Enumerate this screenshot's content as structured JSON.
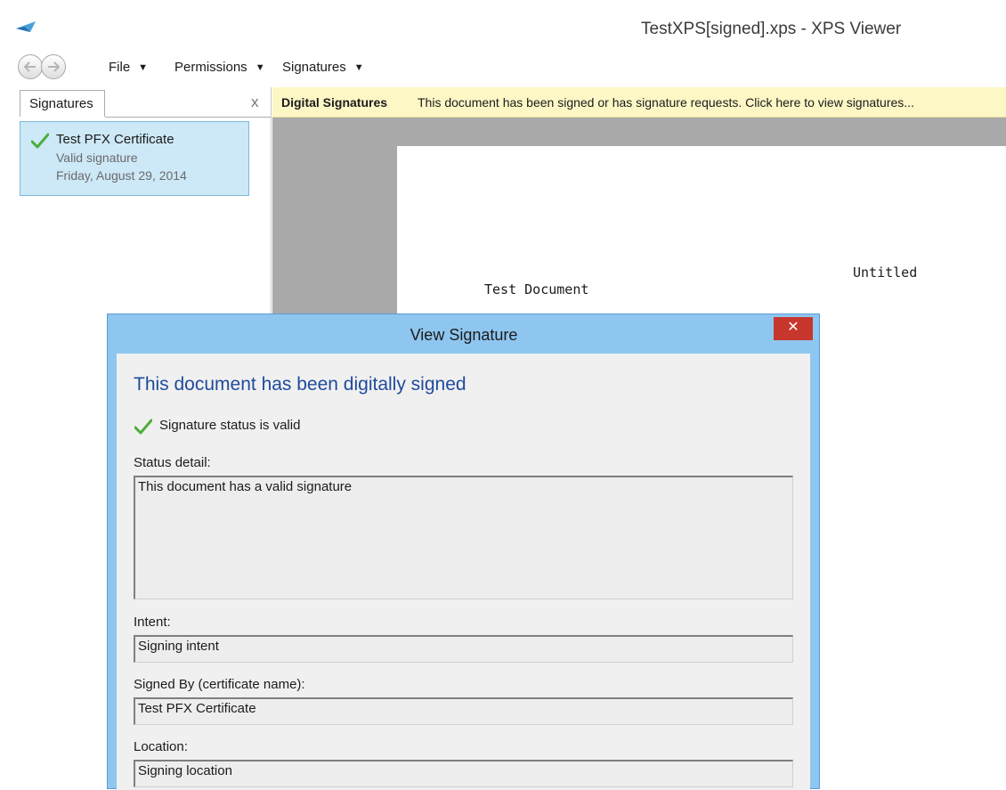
{
  "window": {
    "title": "TestXPS[signed].xps - XPS Viewer",
    "app_icon": "xps-viewer-icon"
  },
  "menu": {
    "items": [
      {
        "label": "File",
        "icon": "caret-down-icon"
      },
      {
        "label": "Permissions",
        "icon": "caret-down-icon"
      },
      {
        "label": "Signatures",
        "icon": "caret-down-icon"
      }
    ],
    "caret": "▼"
  },
  "side_panel": {
    "tab_label": "Signatures",
    "close_glyph": "x",
    "signature": {
      "name": "Test PFX Certificate",
      "status": "Valid signature",
      "date": "Friday, August 29, 2014",
      "icon": "checkmark-icon",
      "icon_color": "#4cae3b"
    }
  },
  "infobar": {
    "title": "Digital Signatures",
    "message": "This document has been signed or has signature requests.  Click here to view signatures..."
  },
  "document": {
    "text_untitled": "Untitled",
    "text_test": "Test Document"
  },
  "dialog": {
    "title": "View Signature",
    "close_glyph": "✕",
    "heading": "This document has been digitally signed",
    "status_text": "Signature status is valid",
    "status_detail_label": "Status detail:",
    "status_detail_value": "This document has a valid signature",
    "intent_label": "Intent:",
    "intent_value": "Signing intent",
    "signed_by_label": "Signed By (certificate name):",
    "signed_by_value": "Test PFX Certificate",
    "location_label": "Location:",
    "location_value": "Signing location",
    "accent_color": "#1f4b9c",
    "close_color": "#c7372d"
  }
}
